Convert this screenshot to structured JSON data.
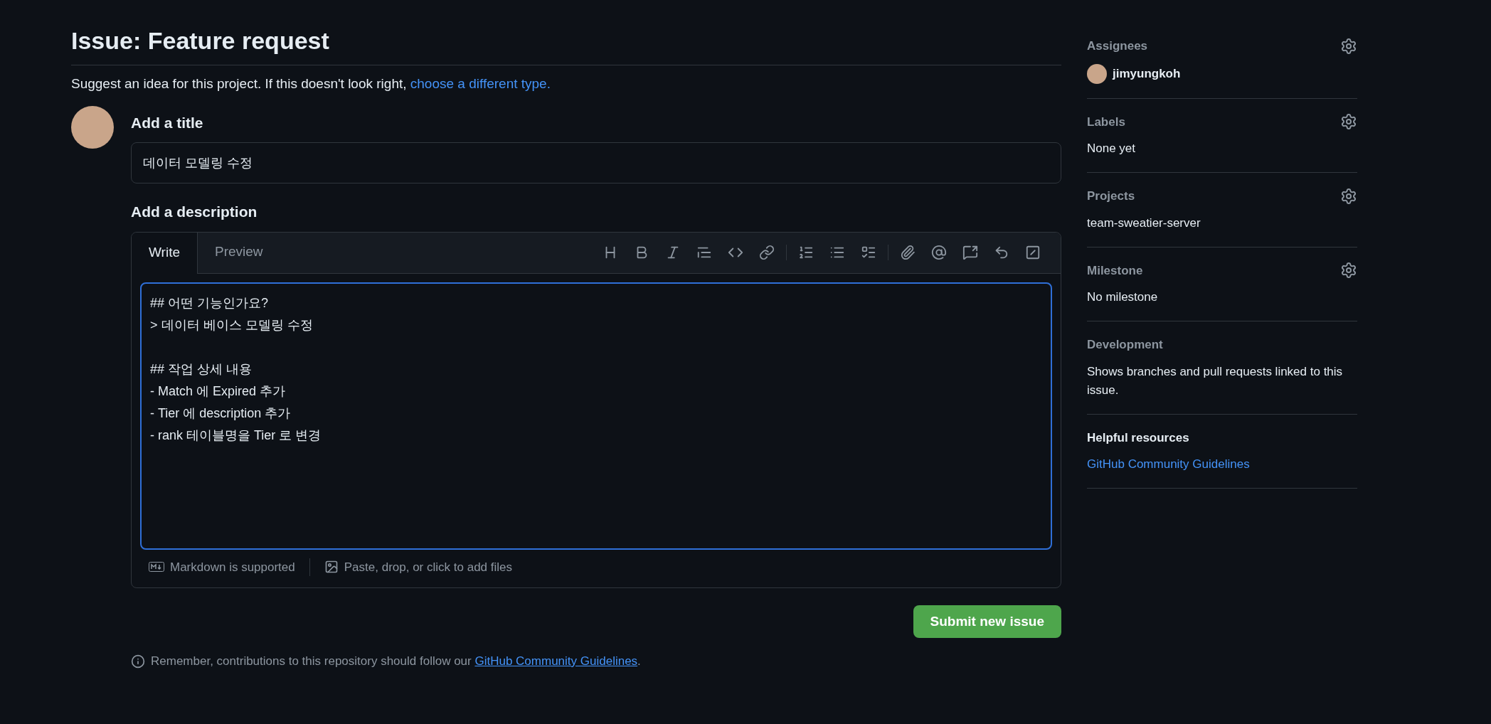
{
  "header": {
    "title": "Issue: Feature request",
    "subtitle": "Suggest an idea for this project. If this doesn't look right,",
    "subtitle_link": "choose a different type."
  },
  "title_section": {
    "label": "Add a title",
    "value": "데이터 모델링 수정"
  },
  "description_section": {
    "label": "Add a description",
    "tabs": [
      {
        "label": "Write",
        "selected": true
      },
      {
        "label": "Preview",
        "selected": false
      }
    ],
    "value": "## 어떤 기능인가요?\n> 데이터 베이스 모델링 수정\n\n## 작업 상세 내용\n- Match 에 Expired 추가\n- Tier 에 description 추가\n- rank 테이블명을 Tier 로 변경",
    "footer": [
      "Markdown is supported",
      "Paste, drop, or click to add files"
    ]
  },
  "submit_button": "Submit new issue",
  "note": {
    "text": "Remember, contributions to this repository should follow our",
    "link": "GitHub Community Guidelines",
    "end": "."
  },
  "sidebar": [
    {
      "kind": "user",
      "heading": "Assignees",
      "value": "jimyungkoh",
      "settings": true
    },
    {
      "kind": "text",
      "heading": "Labels",
      "value": "None yet",
      "settings": true
    },
    {
      "kind": "text",
      "heading": "Projects",
      "value": "team-sweatier-server",
      "settings": true
    },
    {
      "kind": "text",
      "heading": "Milestone",
      "value": "No milestone",
      "settings": true
    },
    {
      "kind": "text",
      "heading": "Development",
      "value": "Shows branches and pull requests linked to this issue.",
      "settings": false
    },
    {
      "kind": "link",
      "heading": "Helpful resources",
      "value": "GitHub Community Guidelines",
      "settings": false
    }
  ]
}
